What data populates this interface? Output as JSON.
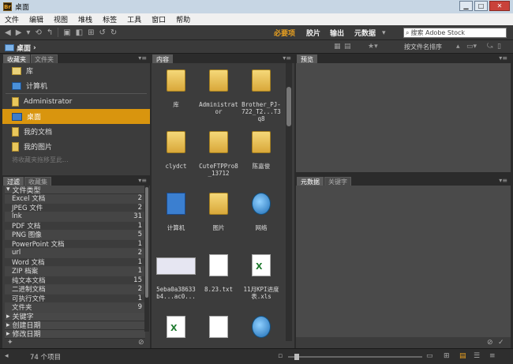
{
  "window": {
    "title": "桌面",
    "app_icon": "Br"
  },
  "menu": [
    "文件",
    "编辑",
    "视图",
    "堆栈",
    "标签",
    "工具",
    "窗口",
    "帮助"
  ],
  "workspaces": [
    {
      "label": "必要项",
      "active": true
    },
    {
      "label": "胶片",
      "active": false
    },
    {
      "label": "输出",
      "active": false
    },
    {
      "label": "元数据",
      "active": false
    }
  ],
  "search": {
    "placeholder": "搜索 Adobe Stock"
  },
  "path": {
    "crumb": "桌面",
    "sort": "按文件名排序"
  },
  "tabs": {
    "favorites": "收藏夹",
    "folders": "文件夹",
    "content": "内容",
    "preview": "预览",
    "filter": "过滤",
    "collections": "收藏集",
    "metadata": "元数据",
    "keywords": "关键字"
  },
  "favorites": {
    "items": [
      {
        "label": "库",
        "icon": "library-icon"
      },
      {
        "label": "计算机",
        "icon": "computer-icon"
      },
      {
        "label": "Administrator",
        "icon": "user-folder-icon"
      },
      {
        "label": "桌面",
        "icon": "desktop-icon",
        "selected": true
      },
      {
        "label": "我的文档",
        "icon": "documents-icon"
      },
      {
        "label": "我的图片",
        "icon": "pictures-icon"
      }
    ],
    "hint": "将收藏夹拖移至此..."
  },
  "filter": {
    "section": "文件类型",
    "rows": [
      {
        "label": "Excel 文档",
        "count": "2"
      },
      {
        "label": "JPEG 文件",
        "count": "2"
      },
      {
        "label": "lnk",
        "count": "31"
      },
      {
        "label": "PDF 文档",
        "count": "1"
      },
      {
        "label": "PNG 图像",
        "count": "5"
      },
      {
        "label": "PowerPoint 文档",
        "count": "1"
      },
      {
        "label": "url",
        "count": "2"
      },
      {
        "label": "Word 文档",
        "count": "1"
      },
      {
        "label": "ZIP 档案",
        "count": "1"
      },
      {
        "label": "纯文本文档",
        "count": "15"
      },
      {
        "label": "二进制文档",
        "count": "2"
      },
      {
        "label": "可执行文件",
        "count": "1"
      },
      {
        "label": "文件夹",
        "count": "9"
      }
    ],
    "collapsed": [
      "关键字",
      "创建日期",
      "修改日期"
    ]
  },
  "content": {
    "items": [
      {
        "label": "库",
        "type": "library"
      },
      {
        "label": "Administrator",
        "type": "folder"
      },
      {
        "label": "Brother_PJ-722_T2...T3q8",
        "type": "folder"
      },
      {
        "label": "clydct",
        "type": "folder"
      },
      {
        "label": "CuteFTPPro8_13712",
        "type": "folder"
      },
      {
        "label": "陈嘉俊",
        "type": "folder"
      },
      {
        "label": "计算机",
        "type": "computer"
      },
      {
        "label": "图片",
        "type": "folder"
      },
      {
        "label": "网络",
        "type": "network"
      },
      {
        "label": "5eba0a38633b4...ac0...",
        "type": "thumb"
      },
      {
        "label": "8.23.txt",
        "type": "file"
      },
      {
        "label": "11月KPI进度表.xls",
        "type": "xls"
      },
      {
        "label": "",
        "type": "xls"
      },
      {
        "label": "",
        "type": "file"
      },
      {
        "label": "",
        "type": "network"
      }
    ]
  },
  "status": {
    "count": "74 个项目"
  }
}
